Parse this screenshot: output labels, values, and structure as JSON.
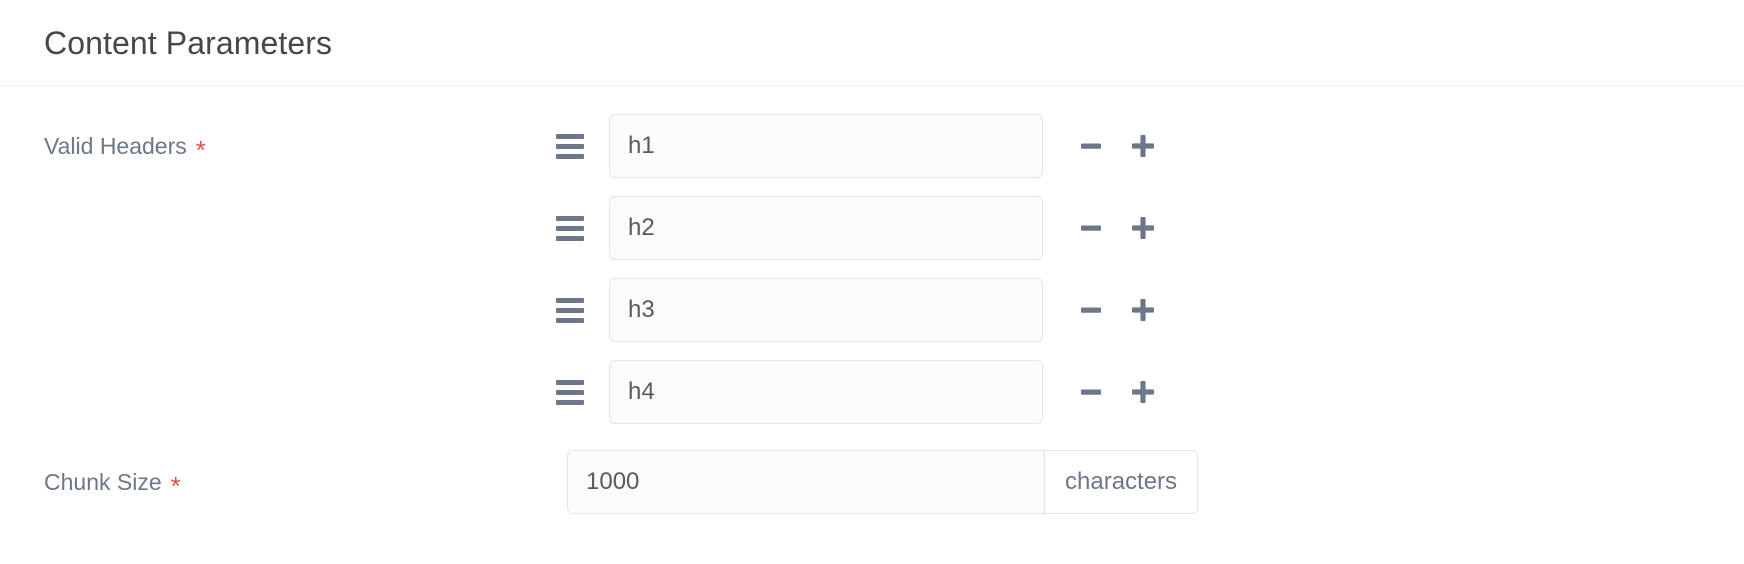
{
  "panel": {
    "title": "Content Parameters"
  },
  "fields": {
    "valid_headers": {
      "label": "Valid Headers",
      "required_marker": "*",
      "required": true,
      "drag_handle_icon": "drag-handle-icon",
      "remove_icon": "minus-icon",
      "add_icon": "plus-icon",
      "items": [
        {
          "value": "h1",
          "placeholder": ""
        },
        {
          "value": "h2",
          "placeholder": ""
        },
        {
          "value": "h3",
          "placeholder": ""
        },
        {
          "value": "h4",
          "placeholder": ""
        }
      ]
    },
    "chunk_size": {
      "label": "Chunk Size",
      "required_marker": "*",
      "required": true,
      "value": "1000",
      "placeholder": "",
      "unit": "characters"
    }
  },
  "colors": {
    "page_background": "#ffffff",
    "title_text": "#44484d",
    "label_text": "#6c7888",
    "required_star": "#e0504a",
    "input_background": "#fbfbfb",
    "input_border": "#e3e5e6",
    "input_text": "#555b63",
    "icon_gray": "#6c7889",
    "divider": "#f2f2f3",
    "addon_background": "#ffffff"
  }
}
